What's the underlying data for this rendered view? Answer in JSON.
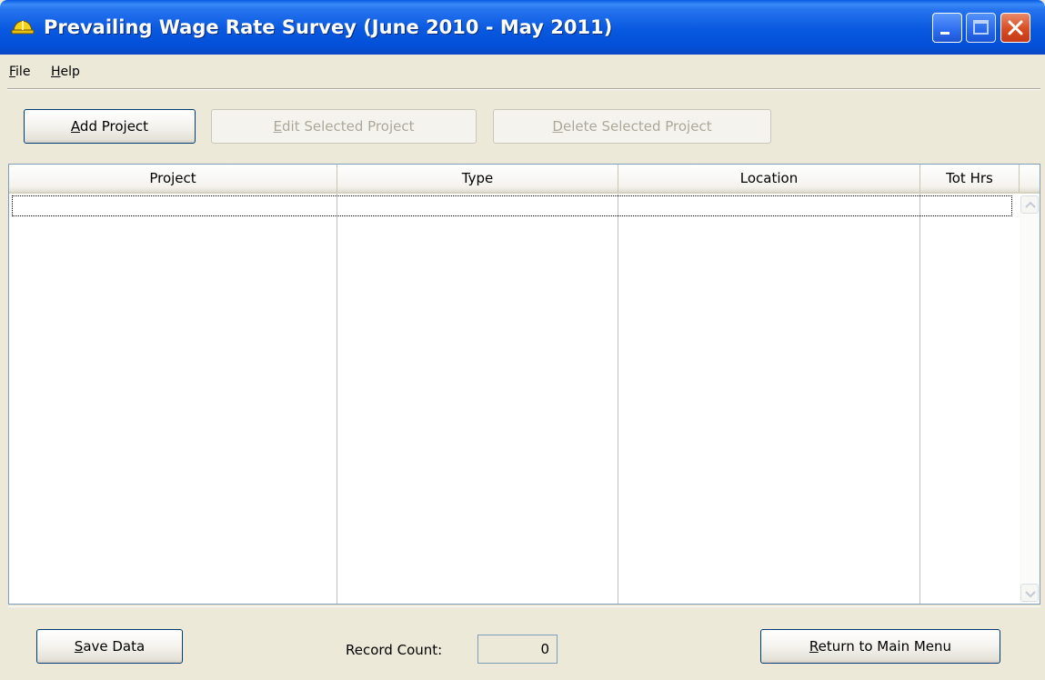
{
  "window": {
    "title": "Prevailing Wage Rate Survey  (June 2010 - May 2011)",
    "icon": "hardhat-icon",
    "controls": [
      "minimize-icon",
      "maximize-icon",
      "close-icon"
    ]
  },
  "menu": {
    "file": "File",
    "help": "Help"
  },
  "toolbar": {
    "add": "Add Project",
    "edit": "Edit Selected Project",
    "delete": "Delete Selected Project"
  },
  "table": {
    "columns": [
      "Project",
      "Type",
      "Location",
      "Tot Hrs"
    ],
    "rows": []
  },
  "footer": {
    "save": "Save Data",
    "record_count_label": "Record Count:",
    "record_count_value": "0",
    "return": "Return to Main Menu"
  },
  "colors": {
    "titlebar": "#0a58e0",
    "face": "#ece9d8",
    "button_border": "#003c74",
    "disabled_text": "#aca899"
  }
}
